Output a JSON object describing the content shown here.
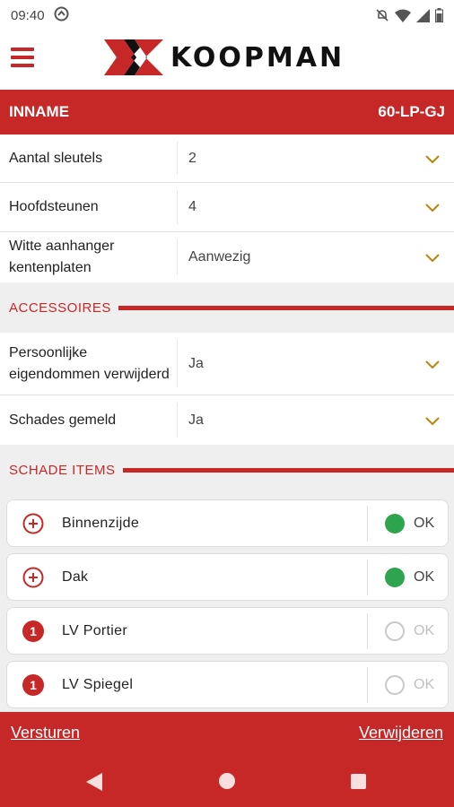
{
  "status_bar": {
    "time": "09:40"
  },
  "brand": {
    "name": "KOOPMAN",
    "accent": "#c62828"
  },
  "title_bar": {
    "left": "INNAME",
    "right": "60-LP-GJ"
  },
  "fields": [
    {
      "label": "Aantal sleutels",
      "value": "2"
    },
    {
      "label": "Hoofdsteunen",
      "value": "4"
    },
    {
      "label": "Witte aanhanger kentenplaten",
      "value": "Aanwezig"
    }
  ],
  "accessoires": {
    "title": "ACCESSOIRES",
    "fields": [
      {
        "label": "Persoonlijke eigendommen verwijderd",
        "value": "Ja"
      },
      {
        "label": "Schades gemeld",
        "value": "Ja"
      }
    ]
  },
  "schade": {
    "title": "SCHADE ITEMS",
    "items": [
      {
        "name": "Binnenzijde",
        "icon": "plus-circle-icon",
        "ok_label": "OK",
        "ok": true
      },
      {
        "name": "Dak",
        "icon": "plus-circle-icon",
        "ok_label": "OK",
        "ok": true
      },
      {
        "name": "LV Portier",
        "icon": "count-badge-icon",
        "count": "1",
        "ok_label": "OK",
        "ok": false
      },
      {
        "name": "LV Spiegel",
        "icon": "count-badge-icon",
        "count": "1",
        "ok_label": "OK",
        "ok": false
      }
    ]
  },
  "actions": {
    "send": "Versturen",
    "delete": "Verwijderen"
  }
}
